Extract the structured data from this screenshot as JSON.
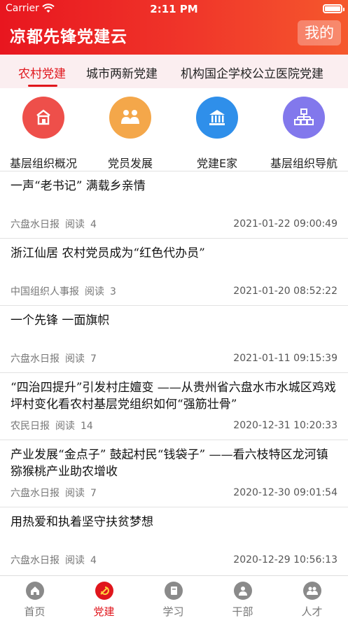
{
  "status_bar": {
    "carrier": "Carrier",
    "time": "2:11 PM"
  },
  "header": {
    "title": "凉都先锋党建云",
    "mine_label": "我的"
  },
  "tabs": [
    {
      "label": "农村党建",
      "active": true
    },
    {
      "label": "城市两新党建",
      "active": false
    },
    {
      "label": "机构国企学校公立医院党建",
      "active": false
    }
  ],
  "quick_links": [
    {
      "label": "基层组织概况",
      "icon": "home-org-icon",
      "color": "#ee4f4a"
    },
    {
      "label": "党员发展",
      "icon": "members-icon",
      "color": "#f4a74a"
    },
    {
      "label": "党建E家",
      "icon": "building-icon",
      "color": "#2f8fea"
    },
    {
      "label": "基层组织导航",
      "icon": "org-chart-icon",
      "color": "#8278ec"
    }
  ],
  "news": [
    {
      "title": "一声“老书记” 满载乡亲情",
      "source": "六盘水日报",
      "read_label": "阅读",
      "read_count": "4",
      "date": "2021-01-22 09:00:49"
    },
    {
      "title": "浙江仙居 农村党员成为“红色代办员”",
      "source": "中国组织人事报",
      "read_label": "阅读",
      "read_count": "3",
      "date": "2021-01-20 08:52:22"
    },
    {
      "title": "一个先锋 一面旗帜",
      "source": "六盘水日报",
      "read_label": "阅读",
      "read_count": "7",
      "date": "2021-01-11 09:15:39"
    },
    {
      "title": "“四治四提升”引发村庄嬗变 ——从贵州省六盘水市水城区鸡戏坪村变化看农村基层党组织如何“强筋壮骨”",
      "source": "农民日报",
      "read_label": "阅读",
      "read_count": "14",
      "date": "2020-12-31 10:20:33"
    },
    {
      "title": "产业发展“金点子” 鼓起村民“钱袋子” ——看六枝特区龙河镇猕猴桃产业助农增收",
      "source": "六盘水日报",
      "read_label": "阅读",
      "read_count": "7",
      "date": "2020-12-30 09:01:54"
    },
    {
      "title": "用热爱和执着坚守扶贫梦想",
      "source": "六盘水日报",
      "read_label": "阅读",
      "read_count": "4",
      "date": "2020-12-29 10:56:13"
    }
  ],
  "tab_bar": [
    {
      "label": "首页",
      "icon": "home-icon",
      "active": false
    },
    {
      "label": "党建",
      "icon": "party-emblem-icon",
      "active": true
    },
    {
      "label": "学习",
      "icon": "book-icon",
      "active": false
    },
    {
      "label": "干部",
      "icon": "cadre-icon",
      "active": false
    },
    {
      "label": "人才",
      "icon": "talent-icon",
      "active": false
    }
  ],
  "colors": {
    "brand_red": "#e0161c",
    "tab_bg": "#fbeef0"
  }
}
